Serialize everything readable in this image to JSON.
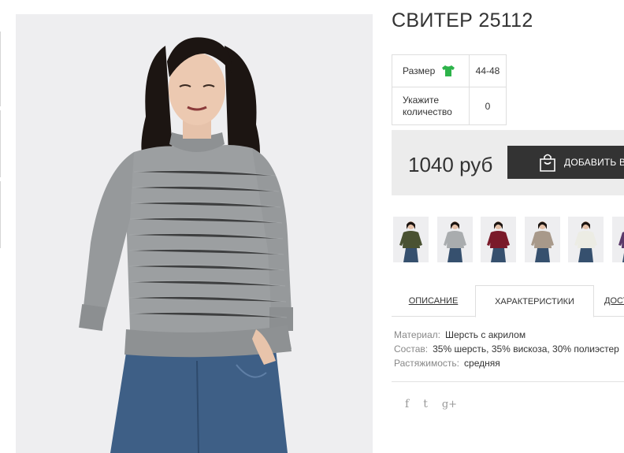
{
  "product": {
    "title": "СВИТЕР 25112"
  },
  "options": {
    "size_label": "Размер",
    "size_value": "44-48",
    "qty_label_line1": "Укажите",
    "qty_label_line2": "количество",
    "qty_value": "0"
  },
  "purchase": {
    "price": "1040 руб",
    "add_to_cart_label": "ДОБАВИТЬ В КОРЗИНУ",
    "button_color": "#333333"
  },
  "thumbnails": [
    {
      "sweater_color": "#4a5232",
      "name": "olive-sweater"
    },
    {
      "sweater_color": "#a9acae",
      "name": "grey-sweater"
    },
    {
      "sweater_color": "#7a1a2a",
      "name": "burgundy-sweater"
    },
    {
      "sweater_color": "#a8998a",
      "name": "beige-sweater"
    },
    {
      "sweater_color": "#ecece4",
      "name": "white-sweater"
    },
    {
      "sweater_color": "#5a3a6a",
      "name": "purple-sweater"
    }
  ],
  "tabs": {
    "description": "ОПИСАНИЕ",
    "characteristics": "ХАРАКТЕРИСТИКИ",
    "more": "ДОСТАВКА"
  },
  "specs": {
    "material_key": "Материал:",
    "material_val": "Шерсть с акрилом",
    "composition_key": "Состав:",
    "composition_val": "35% шерсть, 35% вискоза, 30% полиэстер",
    "stretch_key": "Растяжимость:",
    "stretch_val": "средняя"
  },
  "social": {
    "facebook": "f",
    "twitter": "t",
    "google": "g+"
  },
  "icons": {
    "size_icon": "shirt-icon",
    "size_icon_color": "#2db34a",
    "cart_icon": "shopping-bag-icon"
  }
}
